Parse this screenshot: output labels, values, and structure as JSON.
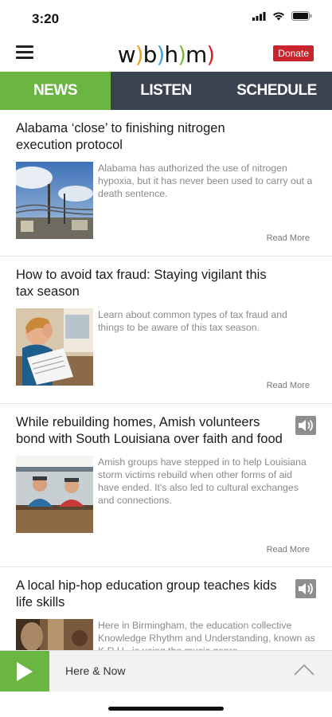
{
  "status": {
    "time": "3:20"
  },
  "header": {
    "logo": {
      "w": "w",
      "p1": ")",
      "b": "b",
      "p2": ")",
      "h": "h",
      "p3": ")",
      "m": "m",
      "p4": ")"
    },
    "donate_label": "Donate",
    "menu_icon": "hamburger-icon"
  },
  "tabs": [
    {
      "label": "NEWS",
      "active": true
    },
    {
      "label": "LISTEN",
      "active": false
    },
    {
      "label": "SCHEDULE",
      "active": false
    }
  ],
  "stories": [
    {
      "title": "Alabama ‘close’ to finishing nitrogen execution protocol",
      "summary": "Alabama has authorized the use of nitrogen hypoxia, but it has never been used to carry out a death sentence.",
      "read_more": "Read More",
      "has_audio": false
    },
    {
      "title": "How to avoid tax fraud: Staying vigilant this tax season",
      "summary": "Learn about common types of tax fraud and things to be aware of this tax season.",
      "read_more": "Read More",
      "has_audio": false
    },
    {
      "title": "While rebuilding homes, Amish volunteers bond with South Louisiana over faith and food",
      "summary": "Amish groups have stepped in to help Louisiana storm victims rebuild when other forms of aid have ended. It's also led to cultural exchanges and connections.",
      "read_more": "Read More",
      "has_audio": true
    },
    {
      "title": "A local hip-hop education group teaches kids life skills",
      "summary": "Here in Birmingham, the education collective Knowledge Rhythm and Understanding, known as K.R.U., is using the music genre",
      "read_more": "",
      "has_audio": true
    }
  ],
  "player": {
    "title": "Here & Now"
  },
  "colors": {
    "accent_green": "#6bb643",
    "tab_dark": "#3c4350",
    "donate_red": "#c9232b"
  }
}
